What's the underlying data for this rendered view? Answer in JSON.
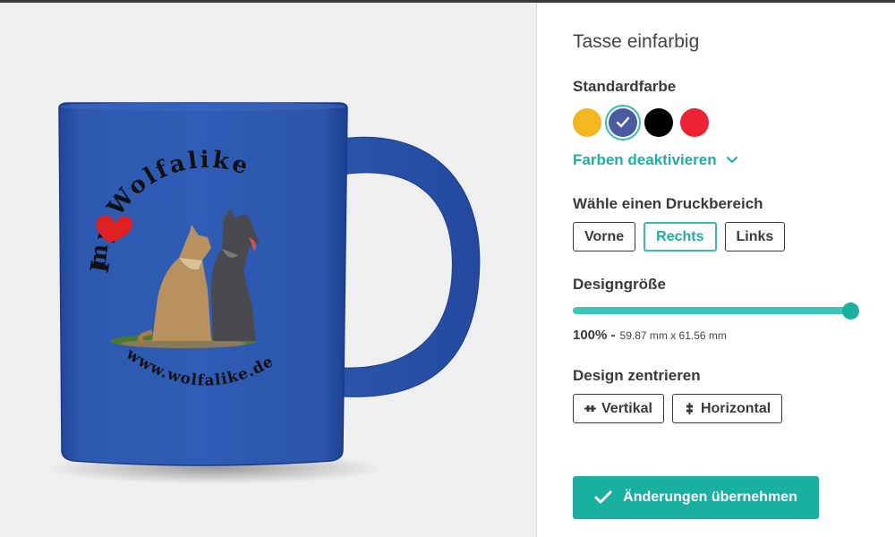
{
  "product": {
    "title": "Tasse einfarbig",
    "image_alt_text": [
      "I",
      "my Wolfalike",
      "www.wolfalike.de"
    ]
  },
  "color": {
    "label": "Standardfarbe",
    "swatches": [
      {
        "name": "yellow",
        "hex": "#f5b71f",
        "selected": false
      },
      {
        "name": "royal-blue",
        "hex": "#2b56a8",
        "selected": true
      },
      {
        "name": "black",
        "hex": "#000000",
        "selected": false
      },
      {
        "name": "red",
        "hex": "#ee2233",
        "selected": false
      }
    ],
    "toggle_label": "Farben deaktivieren"
  },
  "print_area": {
    "label": "Wähle einen Druckbereich",
    "options": [
      {
        "label": "Vorne",
        "active": false
      },
      {
        "label": "Rechts",
        "active": true
      },
      {
        "label": "Links",
        "active": false
      }
    ]
  },
  "design_size": {
    "label": "Designgröße",
    "percent_value": 100,
    "percent_text": "100% -",
    "dimensions": "59.87 mm x 61.56 mm"
  },
  "center": {
    "label": "Design zentrieren",
    "vertical": "Vertikal",
    "horizontal": "Horizontal"
  },
  "apply": {
    "label": "Änderungen übernehmen"
  },
  "colors": {
    "accent": "#1ab0a0",
    "mug": "#2b56a8"
  }
}
